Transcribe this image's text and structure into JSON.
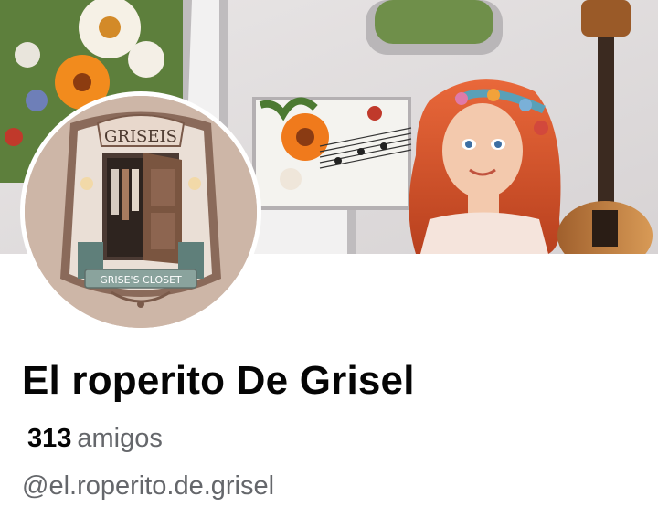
{
  "profile": {
    "name": "El roperito De Grisel",
    "friends_count": "313",
    "friends_label": "amigos",
    "username": "@el.roperito.de.grisel"
  },
  "avatar": {
    "sign_text": "GRISEIS",
    "banner_text": "GRISE'S CLOSET"
  },
  "colors": {
    "name_text": "#050505",
    "secondary_text": "#65676b",
    "background": "#ffffff"
  }
}
